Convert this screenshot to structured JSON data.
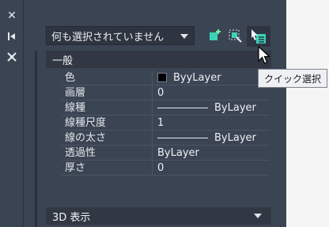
{
  "left_strip": {
    "icons": [
      "close-icon",
      "pin-icon",
      "settings-icon"
    ]
  },
  "selector": {
    "value": "何も選択されていません"
  },
  "toolbar": {
    "icons": [
      "toggle-pickadd-icon",
      "select-objects-icon",
      "quick-select-icon"
    ]
  },
  "sections": [
    {
      "label": "一般"
    },
    {
      "label": "3D 表示"
    }
  ],
  "properties": [
    {
      "key": "色",
      "value": "ByyLayer",
      "kind": "color",
      "swatch_color": "#000000"
    },
    {
      "key": "画層",
      "value": "0",
      "kind": "text"
    },
    {
      "key": "線種",
      "value": "ByLayer",
      "kind": "line"
    },
    {
      "key": "線種尺度",
      "value": "1",
      "kind": "text"
    },
    {
      "key": "線の太さ",
      "value": "ByLayer",
      "kind": "line"
    },
    {
      "key": "透過性",
      "value": "ByLayer",
      "kind": "text"
    },
    {
      "key": "厚さ",
      "value": "0",
      "kind": "text"
    }
  ],
  "tooltip": {
    "text": "クイック選択"
  },
  "colors": {
    "panel_bg": "#3b4453",
    "field_bg": "#2e3541",
    "tooltip_bg": "#eef0f3",
    "accent_green": "#3cd2b8"
  }
}
